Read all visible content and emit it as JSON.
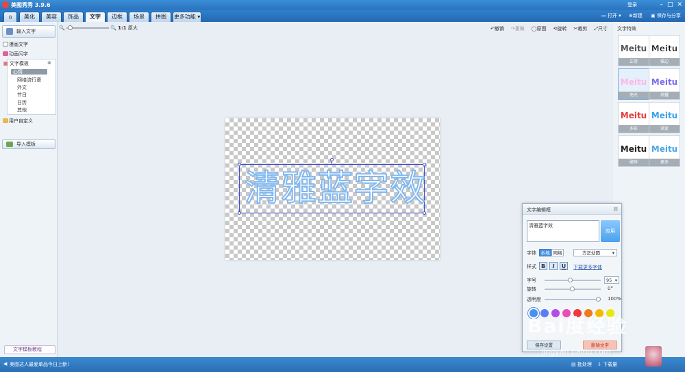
{
  "app": {
    "title": "美图秀秀 3.9.6",
    "account": "登录"
  },
  "tabs": [
    {
      "label": "美化"
    },
    {
      "label": "美容"
    },
    {
      "label": "饰品"
    },
    {
      "label": "文字"
    },
    {
      "label": "边框"
    },
    {
      "label": "场景"
    },
    {
      "label": "拼图"
    },
    {
      "label": "更多功能"
    }
  ],
  "topright": {
    "open": "打开",
    "new": "新建",
    "save": "保存与分享"
  },
  "left": {
    "input_text": "输入文字",
    "comic_text": "漫画文字",
    "anim_text": "动画闪字",
    "template_header": "文字模板",
    "template_items": [
      "心情",
      "网络流行语",
      "外文",
      "节日",
      "日历",
      "其他"
    ],
    "user_defined": "用户自定义",
    "import_template": "导入模板",
    "tutorial": "文字模板教程"
  },
  "zoom": {
    "ratio": "1:1",
    "original": "原大"
  },
  "tools": {
    "undo": "撤销",
    "redo": "重做",
    "original": "原图",
    "rotate": "旋转",
    "crop": "裁剪",
    "size": "尺寸"
  },
  "canvas_text": "清雅蓝字效",
  "effects": {
    "header": "文字特效",
    "items": [
      {
        "word": "Meitu",
        "caption": "正常",
        "color": "#555555"
      },
      {
        "word": "Meitu",
        "caption": "描边",
        "color": "#111111"
      },
      {
        "word": "Meitu",
        "caption": "亮光",
        "color": "#ffb6e8"
      },
      {
        "word": "Meitu",
        "caption": "炫耀",
        "color": "#7a6cf0"
      },
      {
        "word": "Meitu",
        "caption": "多彩",
        "color": "#e23a3a"
      },
      {
        "word": "Meitu",
        "caption": "渐变",
        "color": "#3aa0e8"
      },
      {
        "word": "Meitu",
        "caption": "破碎",
        "color": "#222222"
      },
      {
        "word": "Meitu",
        "caption": "更多",
        "color": "#4aa6e8"
      }
    ]
  },
  "dialog": {
    "title": "文字编辑框",
    "text_value": "清雅蓝字效",
    "apply": "应用",
    "font_label": "字体",
    "font_local": "本地",
    "font_web": "网络",
    "font_name": "方正幼圆",
    "style_label": "样式",
    "bold": "B",
    "italic": "I",
    "underline": "U",
    "download_fonts": "下载更多字体",
    "size_label": "字号",
    "size_value": "95",
    "rotate_label": "旋转",
    "rotate_value": "0°",
    "opacity_label": "透明度",
    "opacity_value": "100%",
    "colors": [
      "#4a90f0",
      "#5b7cf2",
      "#b24de8",
      "#e84db8",
      "#ee3a3a",
      "#f07a1e",
      "#f5b800",
      "#e8e80f"
    ],
    "save_settings": "保存设置",
    "delete_text": "删除文字"
  },
  "status": {
    "message": "美图达人最爱单品今日上新!",
    "batch": "批处理",
    "download": "下载量"
  },
  "watermark": {
    "line1": "Bai度经验",
    "line2": "jingyan.baidu.com"
  }
}
